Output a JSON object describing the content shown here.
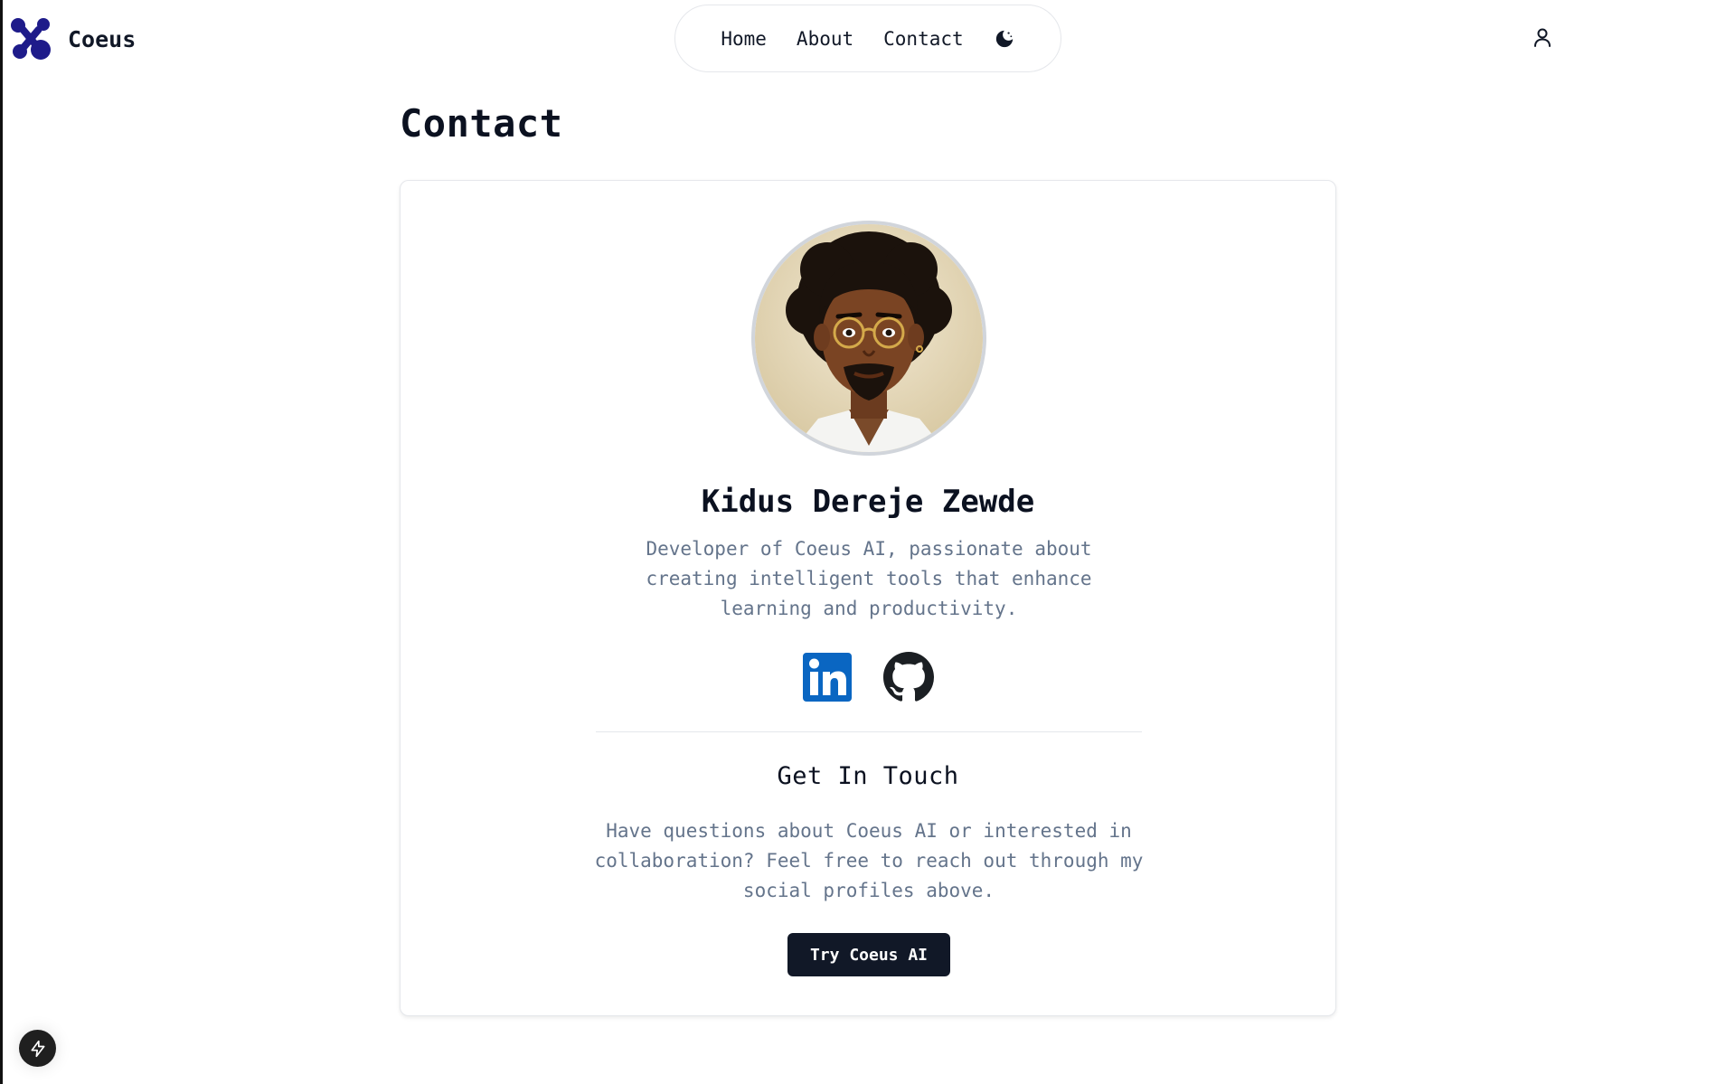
{
  "header": {
    "brand_name": "Coeus",
    "logo_icon": "coeus-logo",
    "nav": [
      {
        "label": "Home"
      },
      {
        "label": "About"
      },
      {
        "label": "Contact"
      }
    ],
    "theme_toggle_icon": "moon-icon",
    "user_icon": "user-icon"
  },
  "page": {
    "title": "Contact"
  },
  "profile": {
    "name": "Kidus Dereje Zewde",
    "bio": "Developer of Coeus AI, passionate about creating intelligent tools that enhance learning and productivity.",
    "socials": [
      {
        "name": "LinkedIn",
        "icon": "linkedin-icon",
        "color": "#0a66c2"
      },
      {
        "name": "GitHub",
        "icon": "github-icon",
        "color": "#1b1f23"
      }
    ]
  },
  "contact": {
    "heading": "Get In Touch",
    "text": "Have questions about Coeus AI or interested in collaboration? Feel free to reach out through my social profiles above.",
    "cta_label": "Try Coeus AI"
  },
  "colors": {
    "brand": "#1e1b8a",
    "primary_button": "#111827",
    "muted_text": "#64748b"
  },
  "floating_button_icon": "lightning-icon"
}
